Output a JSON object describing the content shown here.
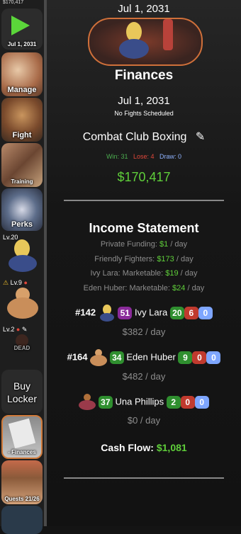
{
  "sidebar": {
    "money": "$170,417",
    "play_date": "Jul 1, 2031",
    "manage": "Manage",
    "fight": "Fight",
    "training": "Training",
    "perks": "Perks",
    "fighter1_level": "Lv.20",
    "fighter2_level": "Lv.9",
    "fighter3_level": "Lv.2",
    "fighter3_status": "DEAD",
    "buy_locker": "Buy Locker",
    "finances": "- Finances",
    "quests": "Quests 21/26"
  },
  "header": {
    "date": "Jul 1, 2031"
  },
  "page": {
    "title": "Finances",
    "date": "Jul 1, 2031",
    "fights": "No Fights Scheduled",
    "club_name": "Combat Club Boxing",
    "win_label": "Win: 31",
    "lose_label": "Lose: 4",
    "draw_label": "Draw: 0",
    "balance": "$170,417"
  },
  "income": {
    "title": "Income Statement",
    "lines": [
      {
        "label": "Private Funding:",
        "amount": "$1",
        "unit": "/ day"
      },
      {
        "label": "Friendly Fighters:",
        "amount": "$173",
        "unit": "/ day"
      },
      {
        "label": "Ivy Lara: Marketable:",
        "amount": "$19",
        "unit": "/ day"
      },
      {
        "label": "Eden Huber: Marketable:",
        "amount": "$24",
        "unit": "/ day"
      }
    ],
    "fighters": [
      {
        "rank": "#142",
        "level": "51",
        "name": "Ivy Lara",
        "wins": "20",
        "losses": "6",
        "draws": "0",
        "income": "$382 / day"
      },
      {
        "rank": "#164",
        "level": "34",
        "name": "Eden Huber",
        "wins": "9",
        "losses": "0",
        "draws": "0",
        "income": "$482 / day"
      },
      {
        "rank": "",
        "level": "37",
        "name": "Una Phillips",
        "wins": "2",
        "losses": "0",
        "draws": "0",
        "income": "$0 / day"
      }
    ],
    "cash_flow_label": "Cash Flow:",
    "cash_flow_value": "$1,081"
  },
  "colors": {
    "accent_green": "#5fcf3a",
    "win": "#4caf50",
    "lose": "#e0473a",
    "draw": "#8fb3ff"
  }
}
